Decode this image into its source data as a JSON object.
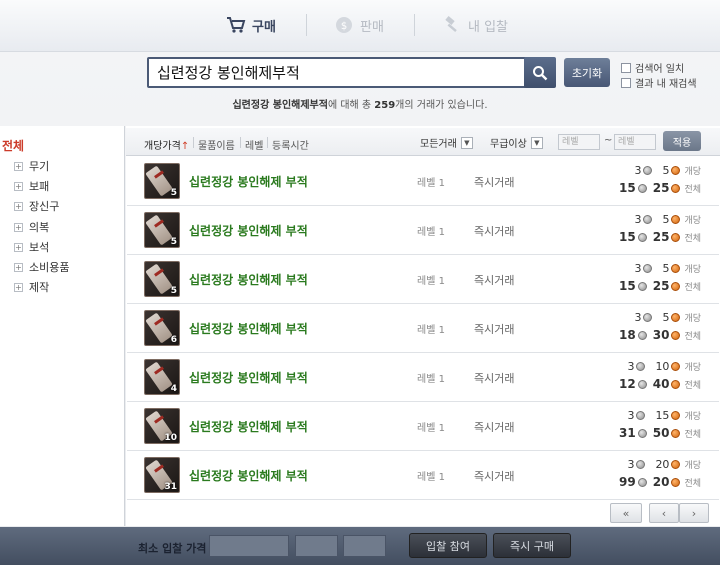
{
  "tabs": [
    {
      "label": "구매",
      "icon": "cart-icon",
      "active": true
    },
    {
      "label": "판매",
      "icon": "sell-icon",
      "active": false
    },
    {
      "label": "내 입찰",
      "icon": "gavel-icon",
      "active": false
    }
  ],
  "search": {
    "value": "십련정강 봉인해제부적",
    "reset_label": "초기화",
    "options": [
      "검색어 일치",
      "결과 내 재검색"
    ],
    "summary_term": "십련정강 봉인해제부적",
    "summary_mid": "에 대해 총 ",
    "summary_count": "259",
    "summary_end": "개의 거래가 있습니다."
  },
  "sidebar": {
    "all_label": "전체",
    "categories": [
      "무기",
      "보패",
      "장신구",
      "의복",
      "보석",
      "소비용품",
      "제작"
    ]
  },
  "header": {
    "sort_price": "개당가격",
    "sort_arrow": "↑",
    "sort_name": "물품이름",
    "sort_level": "레벨",
    "sort_time": "등록시간",
    "trade_filter": "모든거래",
    "grade_filter": "무급이상",
    "level_min_placeholder": "레벨",
    "level_max_placeholder": "레벨",
    "tilde": "~",
    "apply_label": "적용"
  },
  "rows": [
    {
      "name": "십련정강 봉인해제 부적",
      "qty": "5",
      "level": "레벨 1",
      "trade": "즉시거래",
      "unit_silver": "3",
      "unit_gold": "5",
      "total_silver": "15",
      "total_gold": "25",
      "unit_label": "개당",
      "total_label": "전체"
    },
    {
      "name": "십련정강 봉인해제 부적",
      "qty": "5",
      "level": "레벨 1",
      "trade": "즉시거래",
      "unit_silver": "3",
      "unit_gold": "5",
      "total_silver": "15",
      "total_gold": "25",
      "unit_label": "개당",
      "total_label": "전체"
    },
    {
      "name": "십련정강 봉인해제 부적",
      "qty": "5",
      "level": "레벨 1",
      "trade": "즉시거래",
      "unit_silver": "3",
      "unit_gold": "5",
      "total_silver": "15",
      "total_gold": "25",
      "unit_label": "개당",
      "total_label": "전체"
    },
    {
      "name": "십련정강 봉인해제 부적",
      "qty": "6",
      "level": "레벨 1",
      "trade": "즉시거래",
      "unit_silver": "3",
      "unit_gold": "5",
      "total_silver": "18",
      "total_gold": "30",
      "unit_label": "개당",
      "total_label": "전체"
    },
    {
      "name": "십련정강 봉인해제 부적",
      "qty": "4",
      "level": "레벨 1",
      "trade": "즉시거래",
      "unit_silver": "3",
      "unit_gold": "10",
      "total_silver": "12",
      "total_gold": "40",
      "unit_label": "개당",
      "total_label": "전체"
    },
    {
      "name": "십련정강 봉인해제 부적",
      "qty": "10",
      "level": "레벨 1",
      "trade": "즉시거래",
      "unit_silver": "3",
      "unit_gold": "15",
      "total_silver": "31",
      "total_gold": "50",
      "unit_label": "개당",
      "total_label": "전체"
    },
    {
      "name": "십련정강 봉인해제 부적",
      "qty": "31",
      "level": "레벨 1",
      "trade": "즉시거래",
      "unit_silver": "3",
      "unit_gold": "20",
      "total_silver": "99",
      "total_gold": "20",
      "unit_label": "개당",
      "total_label": "전체"
    }
  ],
  "pager": {
    "first": "«",
    "prev": "‹",
    "next": "›"
  },
  "bottom": {
    "min_bid_label": "최소 입찰 가격",
    "bid_button": "입찰 참여",
    "buy_button": "즉시 구매"
  },
  "colors": {
    "accent": "#3f4f6c",
    "item_name": "#2a7a1e",
    "selected_category": "#cc3b2a"
  }
}
